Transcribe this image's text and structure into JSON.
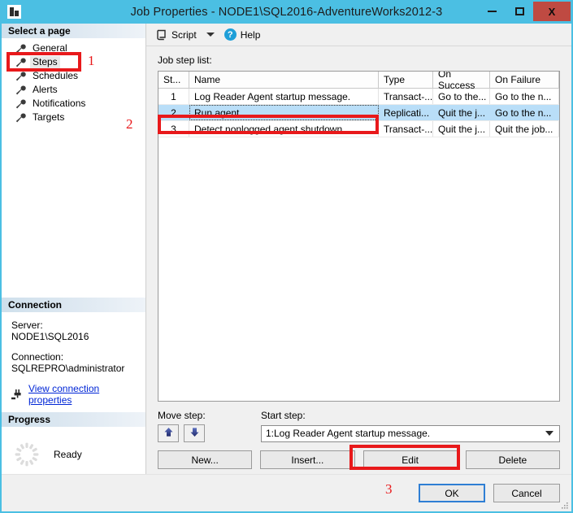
{
  "window": {
    "title": "Job Properties - NODE1\\SQL2016-AdventureWorks2012-3",
    "icon": "window-properties-icon",
    "minimize_label": "",
    "maximize_label": "",
    "close_label": "X"
  },
  "sidebar": {
    "select_page_header": "Select a page",
    "items": [
      {
        "label": "General",
        "icon": "wrench-icon",
        "selected": false
      },
      {
        "label": "Steps",
        "icon": "wrench-icon",
        "selected": true
      },
      {
        "label": "Schedules",
        "icon": "wrench-icon",
        "selected": false
      },
      {
        "label": "Alerts",
        "icon": "wrench-icon",
        "selected": false
      },
      {
        "label": "Notifications",
        "icon": "wrench-icon",
        "selected": false
      },
      {
        "label": "Targets",
        "icon": "wrench-icon",
        "selected": false
      }
    ],
    "connection": {
      "header": "Connection",
      "server_label": "Server:",
      "server_value": "NODE1\\SQL2016",
      "connection_label": "Connection:",
      "connection_value": "SQLREPRO\\administrator",
      "link_text": "View connection properties",
      "link_icon": "plug-icon",
      "link_color": "#0026d6"
    },
    "progress": {
      "header": "Progress",
      "status": "Ready",
      "spinner_icon": "spinner-icon"
    }
  },
  "toolbar": {
    "script_label": "Script",
    "script_icon": "script-icon",
    "dropdown_icon": "chevron-down-icon",
    "help_label": "Help",
    "help_icon": "help-circle-icon"
  },
  "main": {
    "list_label": "Job step list:",
    "columns": [
      "St...",
      "Name",
      "Type",
      "On Success",
      "On Failure"
    ],
    "rows": [
      {
        "id": "1",
        "name": "Log Reader Agent startup message.",
        "type": "Transact-...",
        "on_success": "Go to the...",
        "on_failure": "Go to the n...",
        "selected": false
      },
      {
        "id": "2",
        "name": "Run agent.",
        "type": "Replicati...",
        "on_success": "Quit the j...",
        "on_failure": "Go to the n...",
        "selected": true
      },
      {
        "id": "3",
        "name": "Detect nonlogged agent shutdown.",
        "type": "Transact-...",
        "on_success": "Quit the j...",
        "on_failure": "Quit the job...",
        "selected": false
      }
    ],
    "selection_color": "#b9def8"
  },
  "controls": {
    "move_step_label": "Move step:",
    "move_up_icon": "arrow-up-icon",
    "move_down_icon": "arrow-down-icon",
    "start_step_label": "Start step:",
    "start_step_value": "1:Log Reader Agent startup message.",
    "buttons": {
      "new": "New...",
      "insert": "Insert...",
      "edit": "Edit",
      "delete": "Delete"
    }
  },
  "footer": {
    "ok": "OK",
    "cancel": "Cancel",
    "resize_grip_icon": "resize-grip-icon"
  },
  "annotations": {
    "color": "#e8191b",
    "markers": [
      {
        "number": "1",
        "target": "sidebar-item-steps"
      },
      {
        "number": "2",
        "target": "table-row-2"
      },
      {
        "number": "3",
        "target": "edit-button"
      }
    ]
  }
}
